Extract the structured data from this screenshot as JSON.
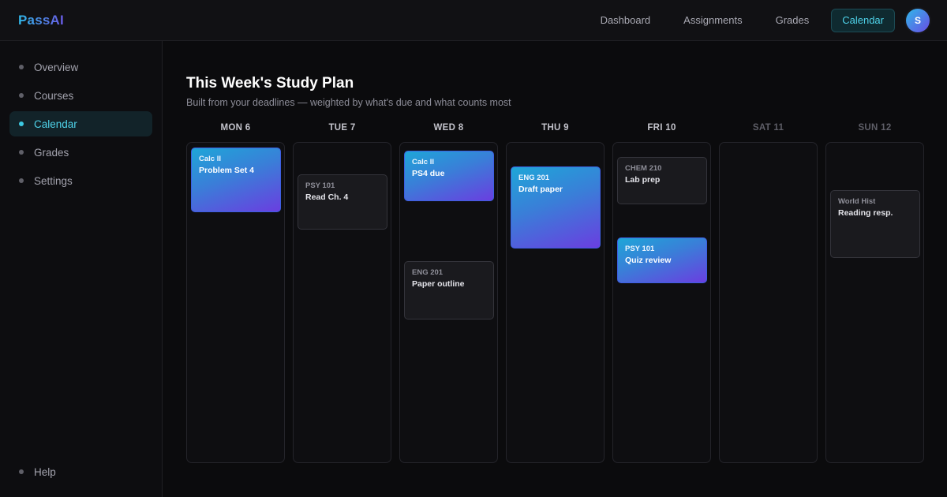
{
  "app": {
    "logo": "PassAI",
    "avatar_initial": "S"
  },
  "nav": {
    "items": [
      "Dashboard",
      "Assignments",
      "Grades",
      "Calendar"
    ],
    "active": "Calendar"
  },
  "sidebar": {
    "items": [
      "Overview",
      "Courses",
      "Calendar",
      "Grades",
      "Settings"
    ],
    "active": "Calendar",
    "footer_item": "Help"
  },
  "main": {
    "title": "This Week's Study Plan",
    "subtitle": "Built from your deadlines — weighted by what's due and what counts most"
  },
  "days": [
    {
      "label": "MON 6",
      "tasks": [
        {
          "course": "Calc II",
          "title": "Problem Set 4",
          "style": "highlight"
        }
      ]
    },
    {
      "label": "TUE 7",
      "tasks": [
        {
          "course": "PSY 101",
          "title": "Read Ch. 4",
          "style": "normal"
        }
      ]
    },
    {
      "label": "WED 8",
      "tasks": [
        {
          "course": "Calc II",
          "title": "PS4 due",
          "style": "highlight"
        },
        {
          "course": "ENG 201",
          "title": "Paper outline",
          "style": "normal"
        }
      ]
    },
    {
      "label": "THU 9",
      "tasks": [
        {
          "course": "ENG 201",
          "title": "Draft paper",
          "style": "highlight"
        }
      ]
    },
    {
      "label": "FRI 10",
      "tasks": [
        {
          "course": "CHEM 210",
          "title": "Lab prep",
          "style": "normal"
        },
        {
          "course": "PSY 101",
          "title": "Quiz review",
          "style": "highlight"
        }
      ]
    },
    {
      "label": "SAT 11",
      "tasks": []
    },
    {
      "label": "SUN 12",
      "tasks": [
        {
          "course": "World Hist",
          "title": "Reading resp.",
          "style": "normal"
        }
      ]
    }
  ],
  "colors": {
    "accent": "#4fd3ea",
    "gradient_start": "#1ea6d8",
    "gradient_end": "#6a3ee0",
    "background": "#0b0b0d"
  }
}
